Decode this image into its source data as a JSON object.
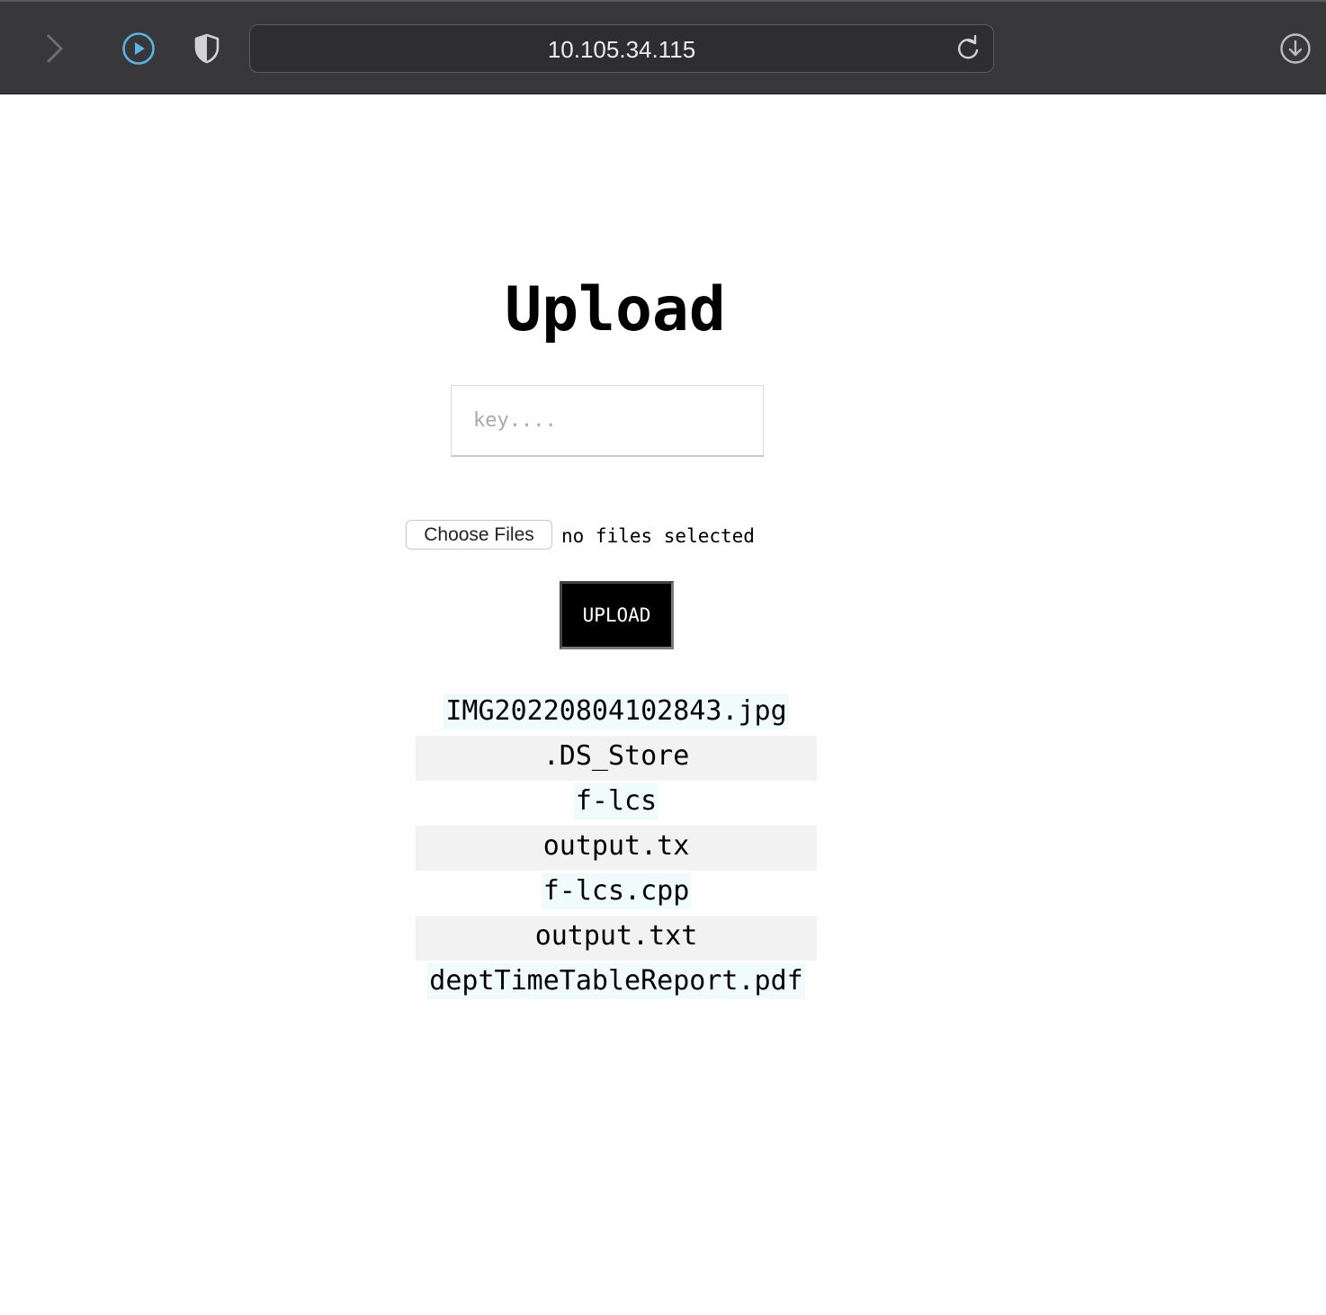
{
  "browser": {
    "url": "10.105.34.115",
    "icons": {
      "forward": "chevron-right-icon",
      "media": "play-circle-icon",
      "privacy": "shield-icon",
      "reload": "reload-icon",
      "downloads": "download-icon"
    },
    "colors": {
      "toolbar": "#38373a",
      "media_accent": "#5ab2e6"
    }
  },
  "page": {
    "title": "Upload",
    "key_placeholder": "key....",
    "choose_files_label": "Choose Files",
    "file_status": "no files selected",
    "upload_label": "UPLOAD",
    "files": [
      "IMG20220804102843.jpg",
      ".DS_Store",
      "f-lcs",
      "output.tx",
      "f-lcs.cpp",
      "output.txt",
      "deptTimeTableReport.pdf"
    ]
  }
}
